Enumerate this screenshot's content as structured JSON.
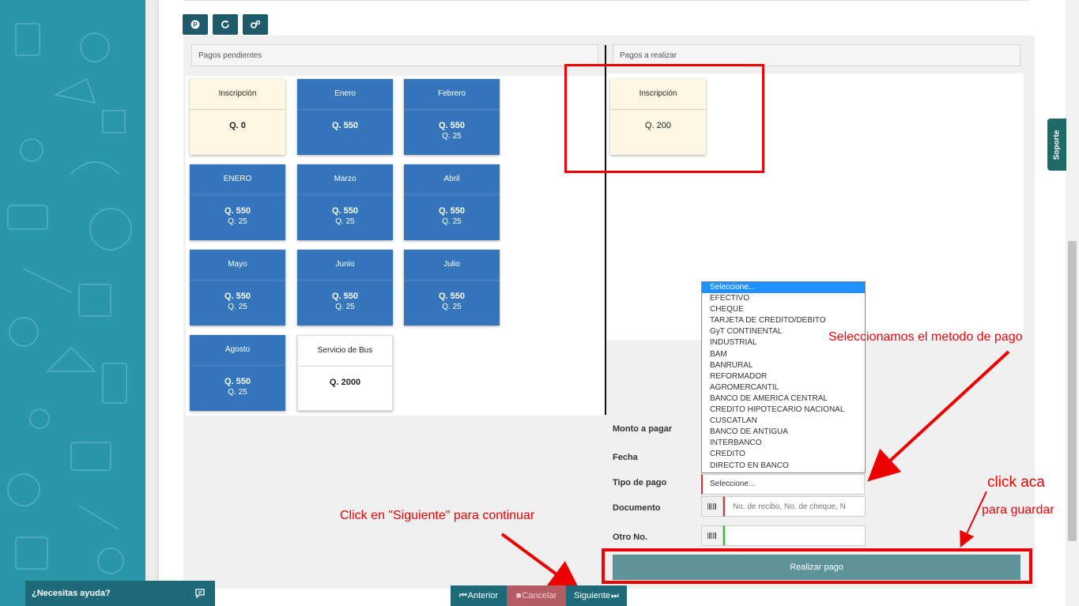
{
  "toolbar": {
    "btn1_icon": "p-circle-icon",
    "btn2_icon": "refresh-icon",
    "btn3_icon": "gears-icon"
  },
  "pendientes_header": "Pagos pendientes",
  "realizar_header": "Pagos a realizar",
  "pending_cards": [
    {
      "title": "Inscripción",
      "amount": "Q. 0",
      "extra": "",
      "style": "cream"
    },
    {
      "title": "Enero",
      "amount": "Q. 550",
      "extra": "",
      "style": "blue"
    },
    {
      "title": "Febrero",
      "amount": "Q. 550",
      "extra": "Q. 25",
      "style": "blue"
    },
    {
      "title": "ENERO",
      "amount": "Q. 550",
      "extra": "Q. 25",
      "style": "blue"
    },
    {
      "title": "Marzo",
      "amount": "Q. 550",
      "extra": "Q. 25",
      "style": "blue"
    },
    {
      "title": "Abril",
      "amount": "Q. 550",
      "extra": "Q. 25",
      "style": "blue"
    },
    {
      "title": "Mayo",
      "amount": "Q. 550",
      "extra": "Q. 25",
      "style": "blue"
    },
    {
      "title": "Junio",
      "amount": "Q. 550",
      "extra": "Q. 25",
      "style": "blue"
    },
    {
      "title": "Julio",
      "amount": "Q. 550",
      "extra": "Q. 25",
      "style": "blue"
    },
    {
      "title": "Agosto",
      "amount": "Q. 550",
      "extra": "Q. 25",
      "style": "blue"
    },
    {
      "title": "Servicio de Bus",
      "amount": "Q. 2000",
      "extra": "",
      "style": "white"
    }
  ],
  "selected_card": {
    "title": "Inscripción",
    "amount": "Q. 200"
  },
  "form": {
    "monto_label": "Monto a pagar",
    "fecha_label": "Fecha",
    "tipo_label": "Tipo de pago",
    "tipo_value": "Seleccione...",
    "documento_label": "Documento",
    "documento_placeholder": "No. de recibo, No. de cheque, N",
    "otro_label": "Otro No.",
    "otro_value": "",
    "barcode_icon": "barcode-icon"
  },
  "payment_options": [
    "Seleccione...",
    "EFECTIVO",
    "CHEQUE",
    "TARJETA DE CREDITO/DEBITO",
    "GyT CONTINENTAL",
    "INDUSTRIAL",
    "BAM",
    "BANRURAL",
    "REFORMADOR",
    "AGROMERCANTIL",
    "BANCO DE AMERICA CENTRAL",
    "CREDITO HIPOTECARIO NACIONAL",
    "CUSCATLAN",
    "BANCO DE ANTIGUA",
    "INTERBANCO",
    "CREDITO",
    "DIRECTO EN BANCO"
  ],
  "realizar_label": "Realizar pago",
  "annotations": {
    "metodo": "Seleccionamos el metodo de pago",
    "click_aca": "click aca",
    "para_guardar": "para guardar",
    "siguiente": "Click en \"Siguiente\" para continuar"
  },
  "soporte_label": "Soporte",
  "help_label": "¿Necesitas ayuda?",
  "nav": {
    "anterior": "Anterior",
    "cancelar": "Cancelar",
    "siguiente": "Siguiente"
  },
  "colors": {
    "accent": "#1e5a6a",
    "card_blue": "#3575bc",
    "card_cream": "#fcf6e2",
    "annotation_red": "#e00000"
  }
}
